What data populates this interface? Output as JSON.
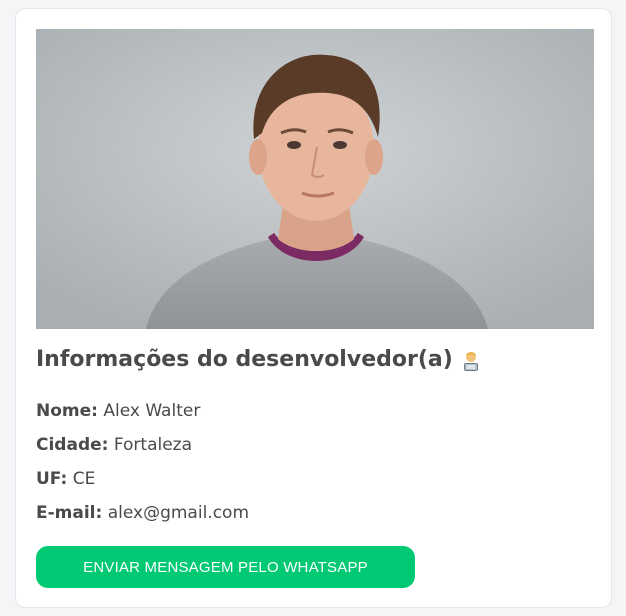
{
  "card": {
    "photo_alt": "Foto do desenvolvedor",
    "title": "Informações do desenvolvedor(a)",
    "title_emoji": "technologist-icon",
    "fields": [
      {
        "label": "Nome:",
        "value": "Alex Walter"
      },
      {
        "label": "Cidade:",
        "value": "Fortaleza"
      },
      {
        "label": "UF:",
        "value": "CE"
      },
      {
        "label": "E-mail:",
        "value": "alex@gmail.com"
      }
    ],
    "button_label": "ENVIAR MENSAGEM PELO WHATSAPP"
  },
  "colors": {
    "button": "#00c974",
    "text": "#4a4a4a",
    "card_background": "#ffffff"
  }
}
